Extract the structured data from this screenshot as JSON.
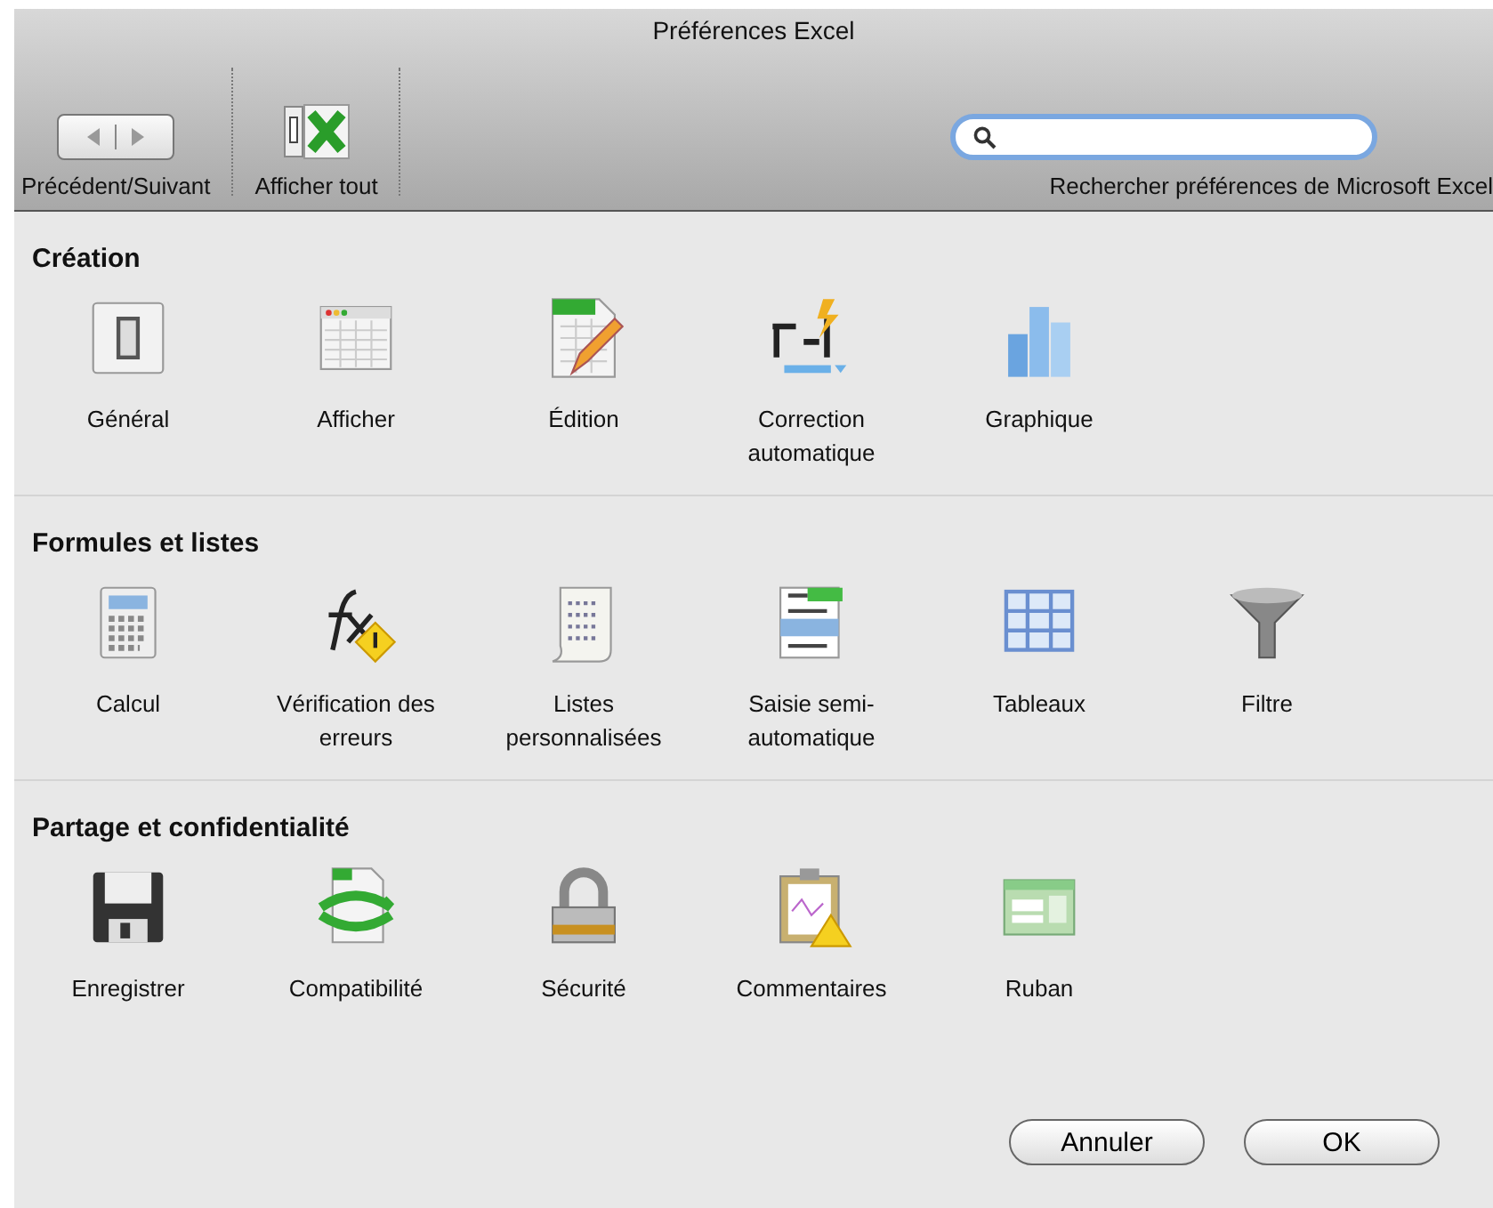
{
  "window": {
    "title": "Préférences Excel"
  },
  "toolbar": {
    "nav_label": "Précédent/Suivant",
    "show_all_label": "Afficher tout",
    "search_label": "Rechercher préférences de Microsoft Excel"
  },
  "sections": [
    {
      "title": "Création",
      "items": [
        {
          "label": "Général"
        },
        {
          "label": "Afficher"
        },
        {
          "label": "Édition"
        },
        {
          "label": "Correction automatique"
        },
        {
          "label": "Graphique"
        }
      ]
    },
    {
      "title": "Formules et listes",
      "items": [
        {
          "label": "Calcul"
        },
        {
          "label": "Vérification des erreurs"
        },
        {
          "label": "Listes personnalisées"
        },
        {
          "label": "Saisie semi-automatique"
        },
        {
          "label": "Tableaux"
        },
        {
          "label": "Filtre"
        }
      ]
    },
    {
      "title": "Partage et confidentialité",
      "items": [
        {
          "label": "Enregistrer"
        },
        {
          "label": "Compatibilité"
        },
        {
          "label": "Sécurité"
        },
        {
          "label": "Commentaires"
        },
        {
          "label": "Ruban"
        }
      ]
    }
  ],
  "buttons": [
    "Annuler",
    "OK"
  ]
}
